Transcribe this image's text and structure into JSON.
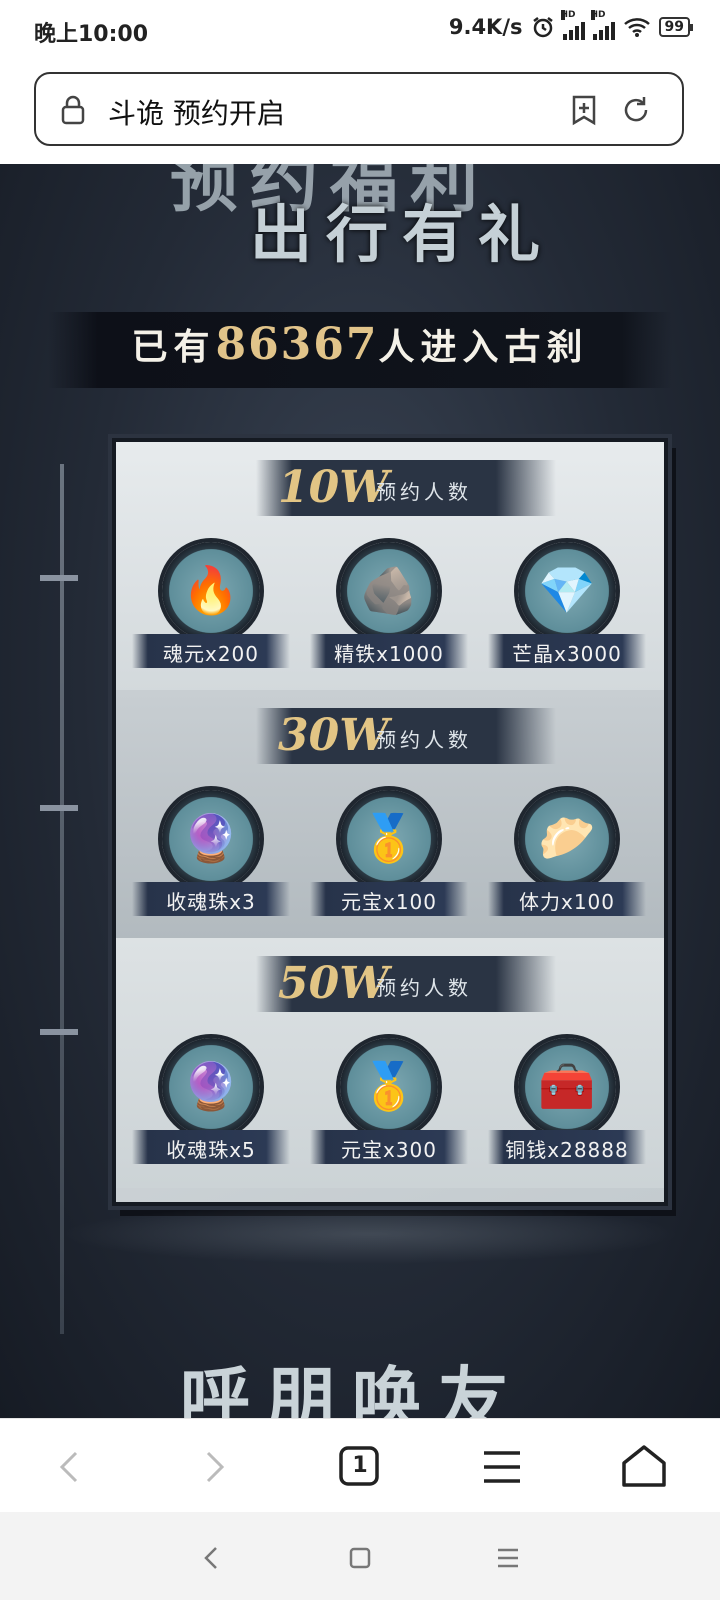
{
  "status_bar": {
    "time": "晚上10:00",
    "net_speed": "9.4K/s",
    "signal1_hd": "HD",
    "signal2_hd": "HD",
    "battery": "99"
  },
  "url_bar": {
    "title": "斗诡 预约开启"
  },
  "page": {
    "hero_partial_top": "预约福利",
    "hero_title": "出行有礼",
    "counter_prefix": "已有",
    "counter_value": "86367",
    "counter_suffix": "人进入古刹",
    "tiers": [
      {
        "threshold": "10W",
        "label": "预约人数",
        "rewards": [
          {
            "name": "魂元x200",
            "icon": "blue-soul-flame-icon",
            "glyph": "🔥"
          },
          {
            "name": "精铁x1000",
            "icon": "iron-ore-icon",
            "glyph": "🪨"
          },
          {
            "name": "芒晶x3000",
            "icon": "blue-crystal-icon",
            "glyph": "💎"
          }
        ]
      },
      {
        "threshold": "30W",
        "label": "预约人数",
        "rewards": [
          {
            "name": "收魂珠x3",
            "icon": "soul-orb-icon",
            "glyph": "🔮"
          },
          {
            "name": "元宝x100",
            "icon": "gold-ingot-icon",
            "glyph": "🥇"
          },
          {
            "name": "体力x100",
            "icon": "steamed-bun-icon",
            "glyph": "🥟"
          }
        ]
      },
      {
        "threshold": "50W",
        "label": "预约人数",
        "rewards": [
          {
            "name": "收魂珠x5",
            "icon": "soul-orb-icon",
            "glyph": "🔮"
          },
          {
            "name": "元宝x300",
            "icon": "gold-ingot-icon",
            "glyph": "🥇"
          },
          {
            "name": "铜钱x28888",
            "icon": "treasure-chest-icon",
            "glyph": "🧰"
          }
        ]
      }
    ],
    "next_section_partial": "呼朋唤友"
  },
  "browser_toolbar": {
    "tab_count": "1",
    "buttons": [
      "back-icon",
      "forward-icon",
      "tabs-icon",
      "menu-icon",
      "home-icon"
    ]
  },
  "system_nav": {
    "buttons": [
      "back-icon",
      "home-icon",
      "recents-icon"
    ]
  },
  "colors": {
    "accent_gold": "#e1c48a",
    "panel_bg": "#d3d9dc",
    "dark_bg": "#232a36"
  }
}
